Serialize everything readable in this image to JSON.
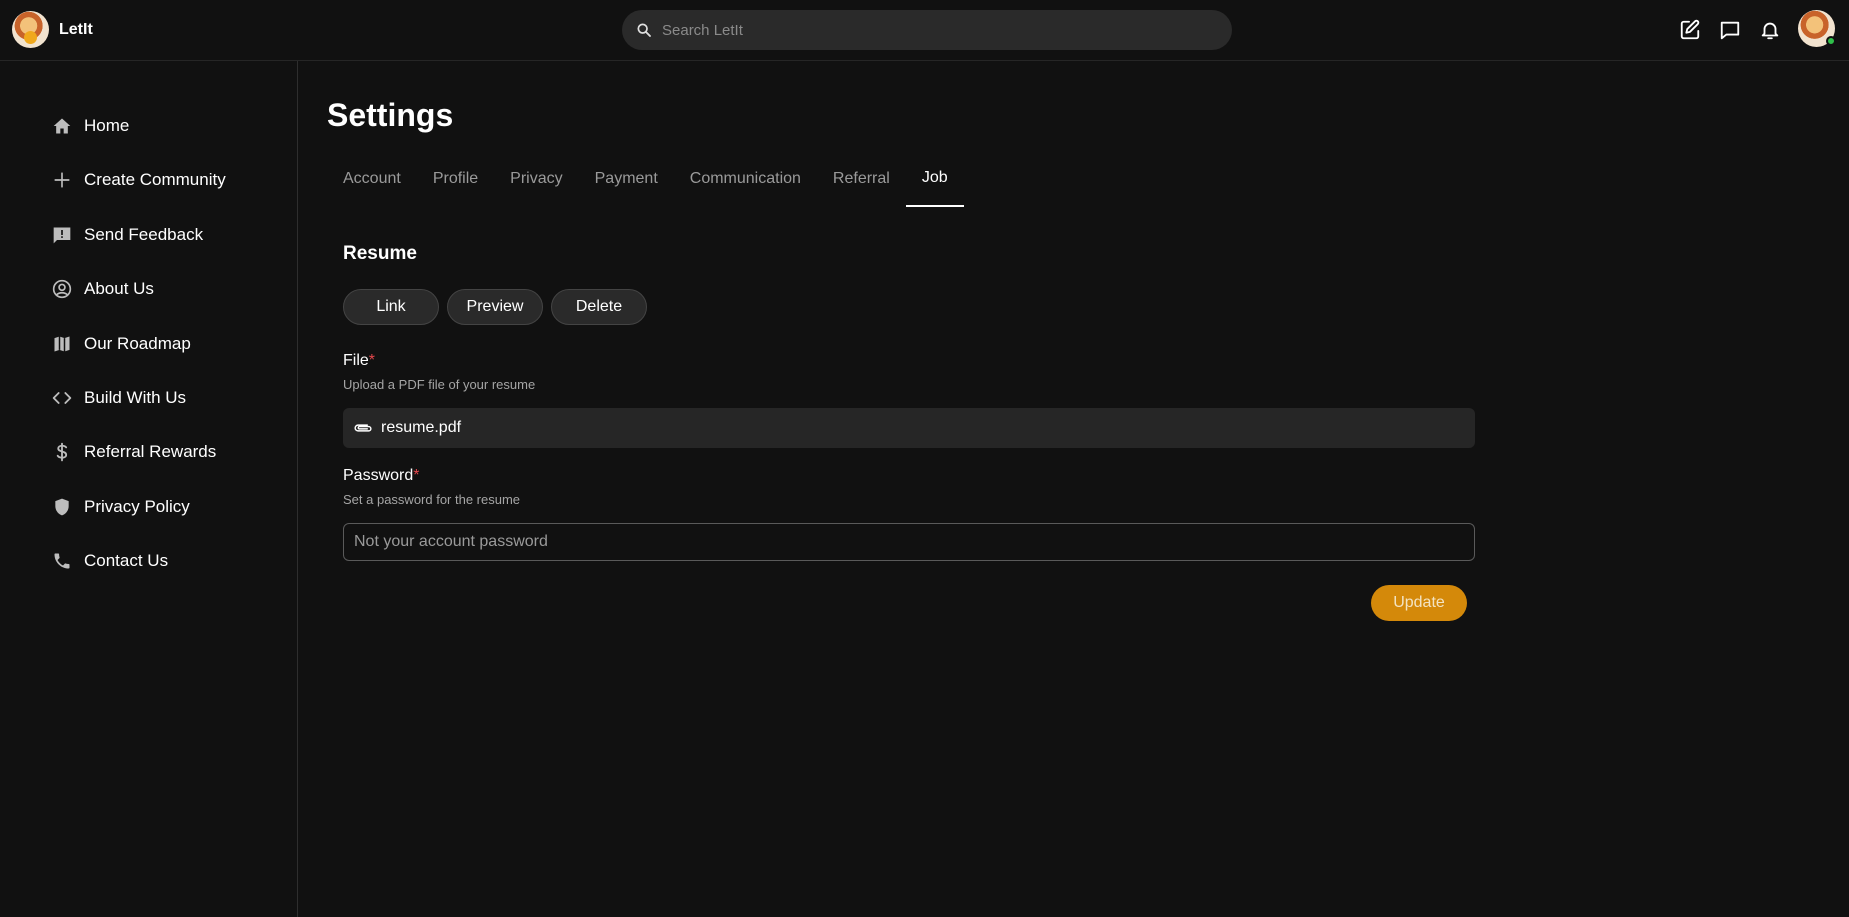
{
  "app": {
    "name": "LetIt",
    "accent_color": "#d4890a",
    "required_color": "#e5484d"
  },
  "search": {
    "placeholder": "Search LetIt",
    "icon": "search-icon"
  },
  "topbar_icons": [
    "edit-icon",
    "chat-icon",
    "bell-icon",
    "user-avatar"
  ],
  "sidebar": {
    "items": [
      {
        "label": "Home",
        "icon": "home-icon"
      },
      {
        "label": "Create Community",
        "icon": "plus-icon"
      },
      {
        "label": "Send Feedback",
        "icon": "feedback-icon"
      },
      {
        "label": "About Us",
        "icon": "user-circle-icon"
      },
      {
        "label": "Our Roadmap",
        "icon": "map-icon"
      },
      {
        "label": "Build With Us",
        "icon": "code-icon"
      },
      {
        "label": "Referral Rewards",
        "icon": "dollar-icon"
      },
      {
        "label": "Privacy Policy",
        "icon": "shield-icon"
      },
      {
        "label": "Contact Us",
        "icon": "phone-icon"
      }
    ]
  },
  "page": {
    "title": "Settings",
    "tabs": [
      {
        "label": "Account"
      },
      {
        "label": "Profile"
      },
      {
        "label": "Privacy"
      },
      {
        "label": "Payment"
      },
      {
        "label": "Communication"
      },
      {
        "label": "Referral"
      },
      {
        "label": "Job",
        "active": true
      }
    ]
  },
  "resume": {
    "title": "Resume",
    "buttons": {
      "link": "Link",
      "preview": "Preview",
      "delete": "Delete"
    },
    "file": {
      "label": "File",
      "required_mark": "*",
      "help": "Upload a PDF file of your resume",
      "value": "resume.pdf"
    },
    "password": {
      "label": "Password",
      "required_mark": "*",
      "help": "Set a password for the resume",
      "placeholder": "Not your account password",
      "value": ""
    },
    "update_label": "Update"
  }
}
